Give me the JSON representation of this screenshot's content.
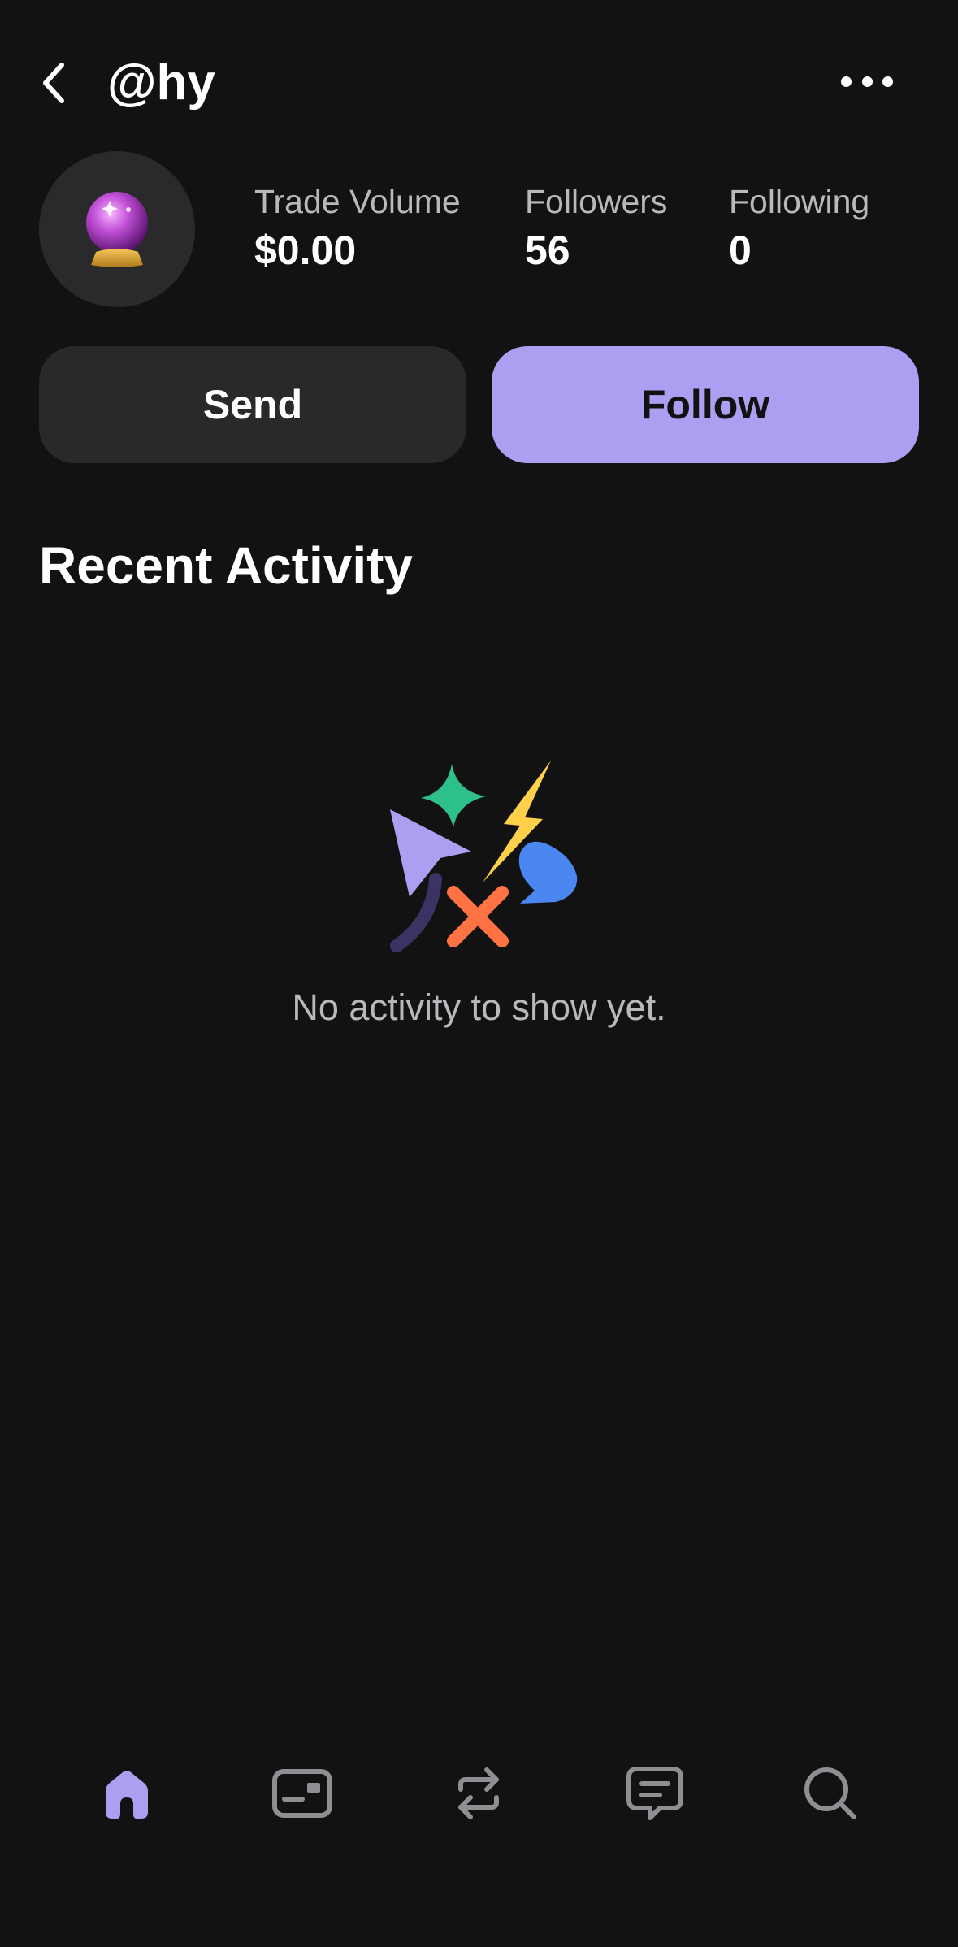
{
  "header": {
    "username": "@hy",
    "back_icon": "chevron-left-icon",
    "more_icon": "ellipsis-icon"
  },
  "profile": {
    "avatar_icon": "crystal-ball-icon",
    "stats": [
      {
        "label": "Trade Volume",
        "value": "$0.00"
      },
      {
        "label": "Followers",
        "value": "56"
      },
      {
        "label": "Following",
        "value": "0"
      }
    ]
  },
  "actions": {
    "send_label": "Send",
    "follow_label": "Follow"
  },
  "activity": {
    "title": "Recent Activity",
    "empty_text": "No activity to show yet."
  },
  "bottom_nav": {
    "items": [
      {
        "icon": "home-icon",
        "active": true
      },
      {
        "icon": "wallet-card-icon",
        "active": false
      },
      {
        "icon": "swap-icon",
        "active": false
      },
      {
        "icon": "chat-icon",
        "active": false
      },
      {
        "icon": "search-icon",
        "active": false
      }
    ]
  },
  "colors": {
    "background": "#121213",
    "accent": "#ab9ff2",
    "secondary_button": "#29292b",
    "muted_text": "#b9b9bd",
    "inactive_icon": "#8e8e93"
  }
}
